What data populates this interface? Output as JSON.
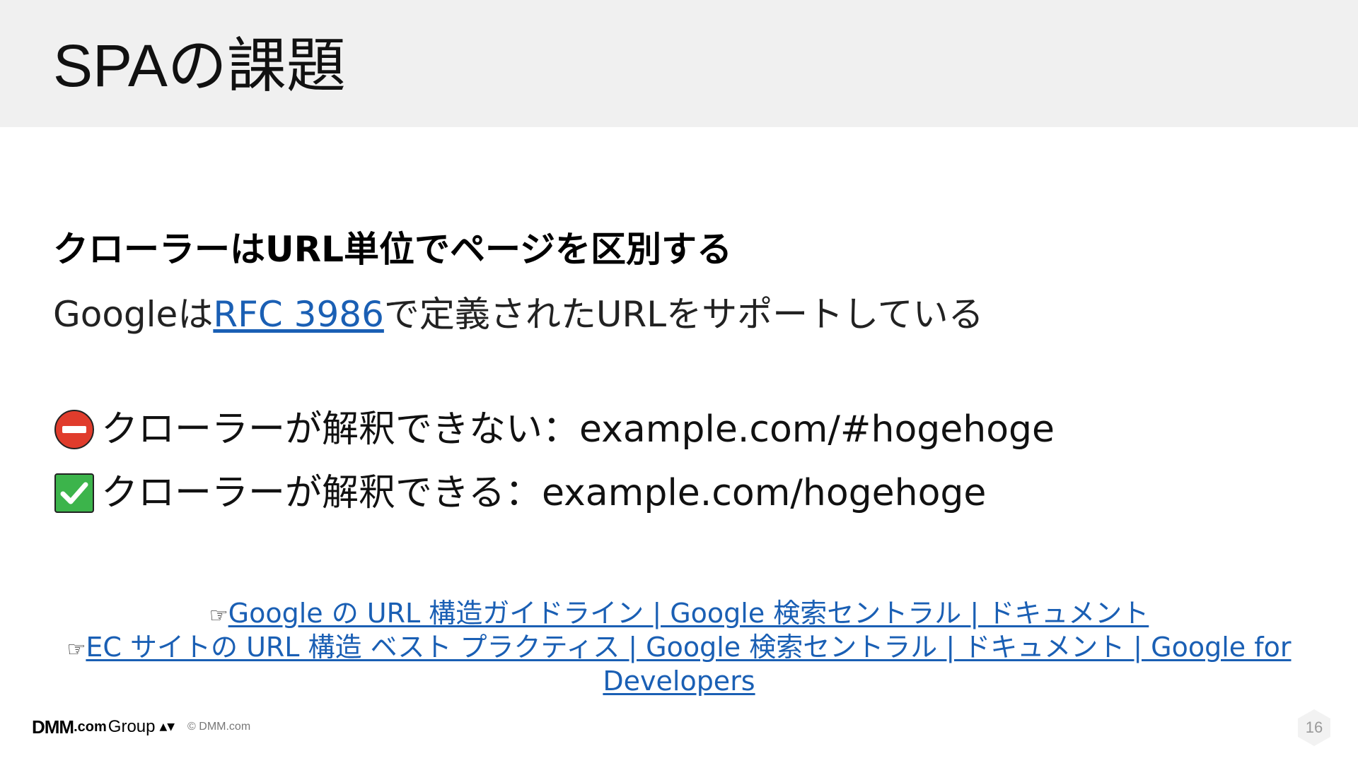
{
  "slide": {
    "title": "SPAの課題",
    "subheading": "クローラーはURL単位でページを区別する",
    "support": {
      "prefix": "Googleは",
      "link_text": "RFC 3986",
      "suffix": "で定義されたURLをサポートしている"
    },
    "examples": [
      {
        "icon": "no-entry-icon",
        "text": "クローラーが解釈できない：example.com/#hogehoge"
      },
      {
        "icon": "check-mark-icon",
        "text": "クローラーが解釈できる：example.com/hogehoge"
      }
    ],
    "references": [
      {
        "marker": "☞",
        "text": "Google の URL 構造ガイドライン | Google 検索セントラル | ドキュメント"
      },
      {
        "marker": "☞",
        "text": "EC サイトの URL 構造 ベスト プラクティス | Google 検索セントラル | ドキュメント | Google for Developers"
      }
    ]
  },
  "footer": {
    "logo_dmm": "DMM",
    "logo_com": ".com",
    "logo_group": "Group",
    "logo_mark": "▲▼",
    "copyright": "© DMM.com",
    "page_number": "16"
  },
  "colors": {
    "header_bg": "#f0f0f0",
    "link": "#1a5fb4",
    "no_entry_red": "#e03c2c",
    "check_green": "#3cb44b"
  }
}
